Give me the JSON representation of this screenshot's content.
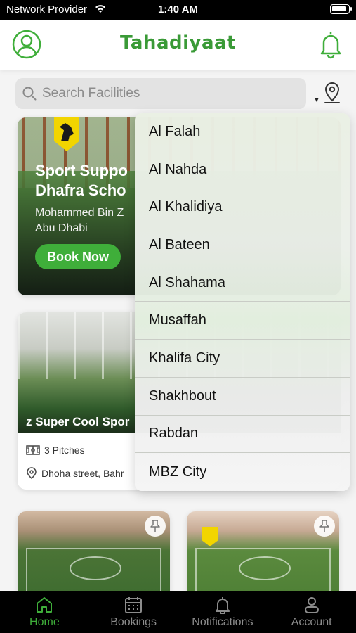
{
  "status_bar": {
    "carrier": "Network Provider",
    "time": "1:40 AM"
  },
  "header": {
    "title": "Tahadiyaat",
    "left_icon": "user-circle-icon",
    "right_icon": "bell-icon"
  },
  "search": {
    "placeholder": "Search Facilities",
    "icon": "search-icon"
  },
  "location_filter": {
    "icon": "location-pin-icon"
  },
  "featured": {
    "title": "Sport Suppo\nDhafra Scho",
    "subtitle": "Mohammed Bin Z\nAbu Dhabi",
    "button_label": "Book Now"
  },
  "facility": {
    "name": "z Super Cool Spor",
    "pitches": "3 Pitches",
    "address": "Dhoha street, Bahr"
  },
  "location_dropdown": {
    "items": [
      "Al Falah",
      "Al Nahda",
      "Al Khalidiya",
      "Al Bateen",
      "Al Shahama",
      "Musaffah",
      "Khalifa City",
      "Shakhbout",
      "Rabdan",
      "MBZ City"
    ]
  },
  "tabbar": {
    "tabs": [
      {
        "label": "Home",
        "icon": "home-icon",
        "active": true
      },
      {
        "label": "Bookings",
        "icon": "calendar-icon",
        "active": false
      },
      {
        "label": "Notifications",
        "icon": "bell-icon",
        "active": false
      },
      {
        "label": "Account",
        "icon": "person-icon",
        "active": false
      }
    ]
  },
  "colors": {
    "brand_green": "#3fae3a",
    "title_green": "#3a9a37",
    "tab_inactive": "#8c8c8c"
  }
}
